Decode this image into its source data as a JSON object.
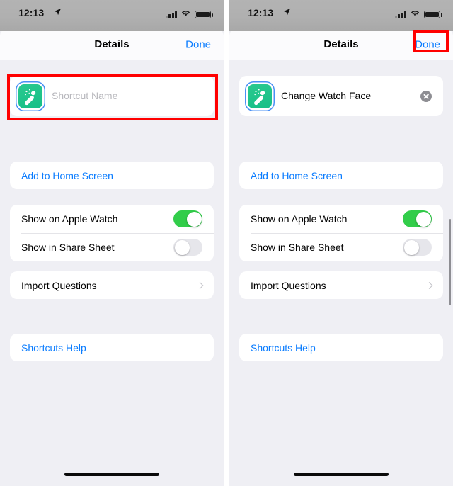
{
  "status_bar": {
    "time": "12:13",
    "location_icon": "location-arrow-icon",
    "signal_icon": "cellular-signal-icon",
    "wifi_icon": "wifi-icon",
    "battery_icon": "battery-full-icon"
  },
  "nav": {
    "title": "Details",
    "done_label": "Done"
  },
  "left_panel": {
    "name_field": {
      "placeholder": "Shortcut Name",
      "value": "",
      "icon": "magic-wand-icon",
      "icon_color": "#16bf87"
    },
    "add_home_screen_label": "Add to Home Screen",
    "toggles": [
      {
        "label": "Show on Apple Watch",
        "state": "on",
        "color": "#32cd4a"
      },
      {
        "label": "Show in Share Sheet",
        "state": "off",
        "color": "#e6e6eb"
      }
    ],
    "import_questions_label": "Import Questions",
    "shortcuts_help_label": "Shortcuts Help"
  },
  "right_panel": {
    "name_field": {
      "placeholder": "Shortcut Name",
      "value": "Change Watch Face",
      "icon": "magic-wand-icon",
      "icon_color": "#16bf87",
      "clear_icon": "clear-circle-icon"
    },
    "add_home_screen_label": "Add to Home Screen",
    "toggles": [
      {
        "label": "Show on Apple Watch",
        "state": "on",
        "color": "#32cd4a"
      },
      {
        "label": "Show in Share Sheet",
        "state": "off",
        "color": "#e6e6eb"
      }
    ],
    "import_questions_label": "Import Questions",
    "shortcuts_help_label": "Shortcuts Help"
  },
  "annotations": {
    "color": "#ff0000",
    "boxes": [
      {
        "target": "shortcut-name-field"
      },
      {
        "target": "done-button"
      }
    ]
  },
  "accent_colors": {
    "link_blue": "#0a7cff",
    "toggle_green": "#32cd4a",
    "icon_teal": "#16bf87",
    "annotation_red": "#ff0000",
    "background_gray": "#efeff4"
  }
}
